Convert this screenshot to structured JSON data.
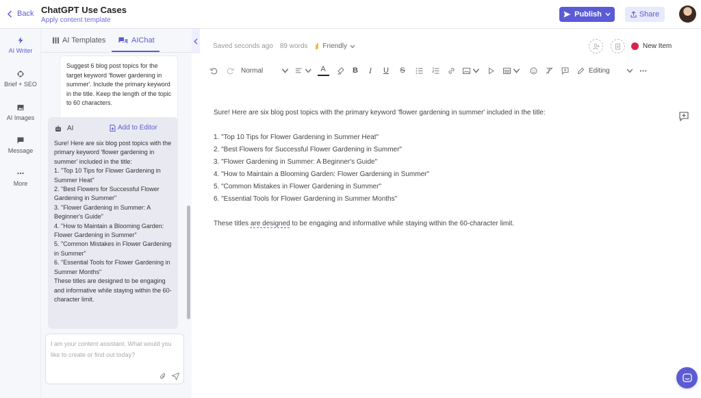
{
  "header": {
    "back_label": "Back",
    "title": "ChatGPT Use Cases",
    "apply_template": "Apply content template",
    "publish_label": "Publish",
    "share_label": "Share"
  },
  "rail": {
    "items": [
      {
        "label": "AI Writer",
        "icon": "lightning-icon",
        "active": true
      },
      {
        "label": "Brief + SEO",
        "icon": "target-icon"
      },
      {
        "label": "AI Images",
        "icon": "image-icon"
      },
      {
        "label": "Message",
        "icon": "message-icon"
      },
      {
        "label": "More",
        "icon": "more-icon"
      }
    ]
  },
  "panel": {
    "tabs": [
      {
        "label": "AI Templates",
        "icon": "grid-icon"
      },
      {
        "label": "AIChat",
        "icon": "chat-icon",
        "active": true
      }
    ],
    "user_message": "Suggest 6 blog post topics for the target keyword 'flower gardening in summer'. Include the primary keyword in the title. Keep the length of the topic to 60 characters.",
    "ai_label": "AI",
    "add_to_editor": "Add to Editor",
    "ai_lines": [
      "Sure! Here are six blog post topics with the primary keyword 'flower gardening in summer' included in the title:",
      "1. \"Top 10 Tips for Flower Gardening in Summer Heat\"",
      "2. \"Best Flowers for Successful Flower Gardening in Summer\"",
      "3. \"Flower Gardening in Summer: A Beginner's Guide\"",
      "4. \"How to Maintain a Blooming Garden: Flower Gardening in Summer\"",
      "5. \"Common Mistakes in Flower Gardening in Summer\"",
      "6. \"Essential Tools for Flower Gardening in Summer Months\"",
      "These titles are designed to be engaging and informative while staying within the 60-character limit."
    ],
    "input_placeholder": "I am your content assistant. What would you like to create or find out today?"
  },
  "status": {
    "saved": "Saved seconds ago",
    "word_count": "89 words",
    "tone": "Friendly",
    "new_item": "New Item"
  },
  "toolbar": {
    "style_label": "Normal",
    "mode_label": "Editing",
    "bold": "B",
    "italic": "I",
    "underline": "U",
    "strike": "S"
  },
  "editor": {
    "intro": "Sure! Here are six blog post topics with the primary keyword 'flower gardening in summer' included in the title:",
    "items": [
      "1. \"Top 10 Tips for Flower Gardening in Summer Heat\"",
      "2. \"Best Flowers for Successful Flower Gardening in Summer\"",
      "3. \"Flower Gardening in Summer: A Beginner's Guide\"",
      "4. \"How to Maintain a Blooming Garden: Flower Gardening in Summer\"",
      "5. \"Common Mistakes in Flower Gardening in Summer\"",
      "6. \"Essential Tools for Flower Gardening in Summer Months\""
    ],
    "outro_before": "These titles ",
    "outro_marked": "are designed",
    "outro_after": " to be engaging and informative while staying within the 60-character limit."
  },
  "colors": {
    "accent": "#5b5bd6",
    "new_item_dot": "#d8234b"
  }
}
